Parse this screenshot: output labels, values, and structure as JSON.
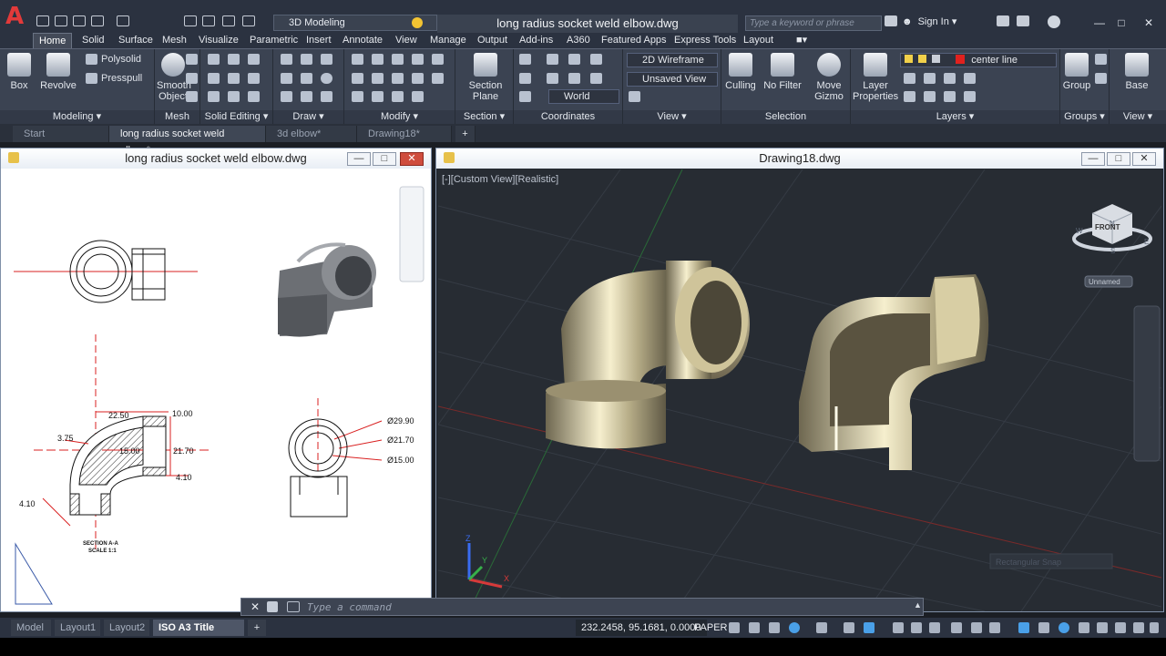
{
  "titlebar": {
    "workspace": "3D Modeling",
    "doc_title": "long radius socket weld elbow.dwg",
    "search_placeholder": "Type a keyword or phrase",
    "sign_in": "Sign In"
  },
  "ribbon_tabs": [
    "Home",
    "Solid",
    "Surface",
    "Mesh",
    "Visualize",
    "Parametric",
    "Insert",
    "Annotate",
    "View",
    "Manage",
    "Output",
    "Add-ins",
    "A360",
    "Featured Apps",
    "Express Tools",
    "Layout"
  ],
  "ribbon_active_tab": "Home",
  "ribbon": {
    "modeling": {
      "label": "Modeling",
      "box": "Box",
      "revolve": "Revolve",
      "polysolid": "Polysolid",
      "presspull": "Presspull"
    },
    "mesh": {
      "label": "Mesh",
      "smooth": "Smooth",
      "object": "Object"
    },
    "solid_editing": {
      "label": "Solid Editing"
    },
    "draw": {
      "label": "Draw"
    },
    "modify": {
      "label": "Modify"
    },
    "section": {
      "label": "Section",
      "plane_1": "Section",
      "plane_2": "Plane"
    },
    "coordinates": {
      "label": "Coordinates",
      "ucs": "World"
    },
    "view": {
      "label": "View",
      "visual_style": "2D Wireframe",
      "named_view": "Unsaved View"
    },
    "selection": {
      "label": "Selection",
      "culling": "Culling",
      "no_filter": "No Filter",
      "move_gizmo_1": "Move",
      "move_gizmo_2": "Gizmo"
    },
    "layers": {
      "label": "Layers",
      "layer_properties_1": "Layer",
      "layer_properties_2": "Properties",
      "current_layer": "center line"
    },
    "groups": {
      "label": "Groups",
      "group": "Group"
    },
    "view2": {
      "label": "View",
      "base": "Base"
    }
  },
  "doc_tabs": [
    "Start",
    "long radius socket weld elbow*",
    "3d elbow*",
    "Drawing18*"
  ],
  "left_window": {
    "title": "long radius socket weld elbow.dwg",
    "dims": {
      "d1": "22.50",
      "d2": "10.00",
      "d3": "3.75",
      "d4": "15.00",
      "d5": "21.70",
      "d6": "4.10",
      "d7": "4.10",
      "r1": "Ø29.90",
      "r2": "Ø21.70",
      "r3": "Ø15.00",
      "section": "SECTION A-A",
      "scale": "SCALE 1:1"
    }
  },
  "right_window": {
    "title": "Drawing18.dwg",
    "viewport_label": "[-][Custom View][Realistic]",
    "viewcube_face": "FRONT",
    "viewcube_n": "N",
    "viewcube_w": "W",
    "viewcube_e": "E",
    "viewcube_s": "S",
    "wcs_menu": "Unnamed",
    "axis_x": "X",
    "axis_y": "Y",
    "axis_z": "Z",
    "tooltip": "Rectangular Snap"
  },
  "command_line": {
    "placeholder": "Type a command"
  },
  "layout_tabs": [
    "Model",
    "Layout1",
    "Layout2",
    "ISO A3 Title Block"
  ],
  "layout_active": "ISO A3 Title Block",
  "status": {
    "coords": "232.2458, 95.1681, 0.0000",
    "space": "PAPER"
  },
  "colors": {
    "brand": "#e23a3a",
    "accent_red": "#d02020",
    "ribbon": "#3b4352",
    "title": "#2b3240"
  }
}
